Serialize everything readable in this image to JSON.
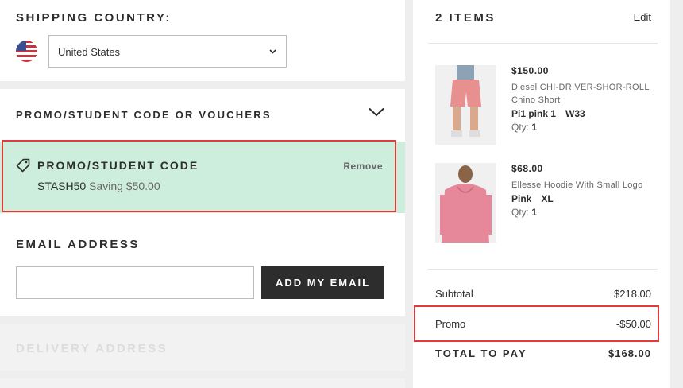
{
  "shipping": {
    "heading": "SHIPPING COUNTRY:",
    "country": "United States",
    "flag_icon": "us-flag-icon"
  },
  "promo": {
    "heading": "PROMO/STUDENT CODE OR VOUCHERS",
    "applied_title": "PROMO/STUDENT CODE",
    "remove_label": "Remove",
    "code": "STASH50",
    "saving": "Saving $50.00",
    "box_color": "#cdeedd"
  },
  "email": {
    "heading": "EMAIL ADDRESS",
    "value": "",
    "button_label": "ADD MY EMAIL"
  },
  "delivery": {
    "heading": "DELIVERY ADDRESS"
  },
  "summary": {
    "title": "2 ITEMS",
    "edit_label": "Edit",
    "items": [
      {
        "price": "$150.00",
        "name": "Diesel CHI-DRIVER-SHOR-ROLL Chino Short",
        "color": "Pi1 pink 1",
        "size": "W33",
        "qty_label": "Qty:",
        "qty": "1"
      },
      {
        "price": "$68.00",
        "name": "Ellesse Hoodie With Small Logo",
        "color": "Pink",
        "size": "XL",
        "qty_label": "Qty:",
        "qty": "1"
      }
    ],
    "subtotal_label": "Subtotal",
    "subtotal": "$218.00",
    "promo_label": "Promo",
    "promo_value": "-$50.00",
    "total_label": "TOTAL TO PAY",
    "total": "$168.00"
  },
  "colors": {
    "highlight": "#e23a3a",
    "button": "#2d2d2d",
    "background": "#eeeeee"
  }
}
